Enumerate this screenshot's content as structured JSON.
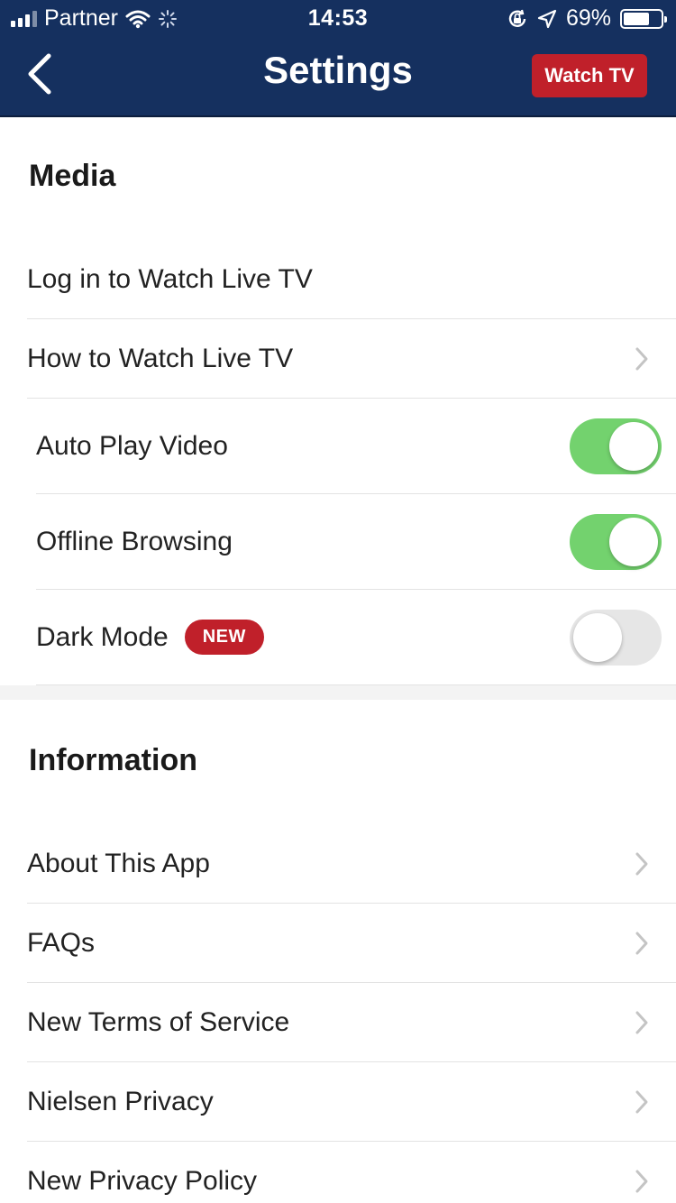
{
  "status_bar": {
    "carrier": "Partner",
    "time": "14:53",
    "battery": "69%",
    "battery_level": 0.69
  },
  "nav": {
    "title": "Settings",
    "watch_tv_label": "Watch TV"
  },
  "colors": {
    "header_bg": "#15305f",
    "accent_red": "#c0202a",
    "toggle_on": "#73d26e"
  },
  "media": {
    "title": "Media",
    "items": [
      {
        "label": "Log in to Watch Live TV"
      },
      {
        "label": "How to Watch Live TV"
      },
      {
        "label": "Auto Play Video",
        "toggle": true
      },
      {
        "label": "Offline Browsing",
        "toggle": true
      },
      {
        "label": "Dark Mode",
        "badge": "NEW",
        "toggle": false
      }
    ]
  },
  "information": {
    "title": "Information",
    "items": [
      {
        "label": "About This App"
      },
      {
        "label": "FAQs"
      },
      {
        "label": "New Terms of Service"
      },
      {
        "label": "Nielsen Privacy"
      },
      {
        "label": "New Privacy Policy"
      }
    ]
  }
}
